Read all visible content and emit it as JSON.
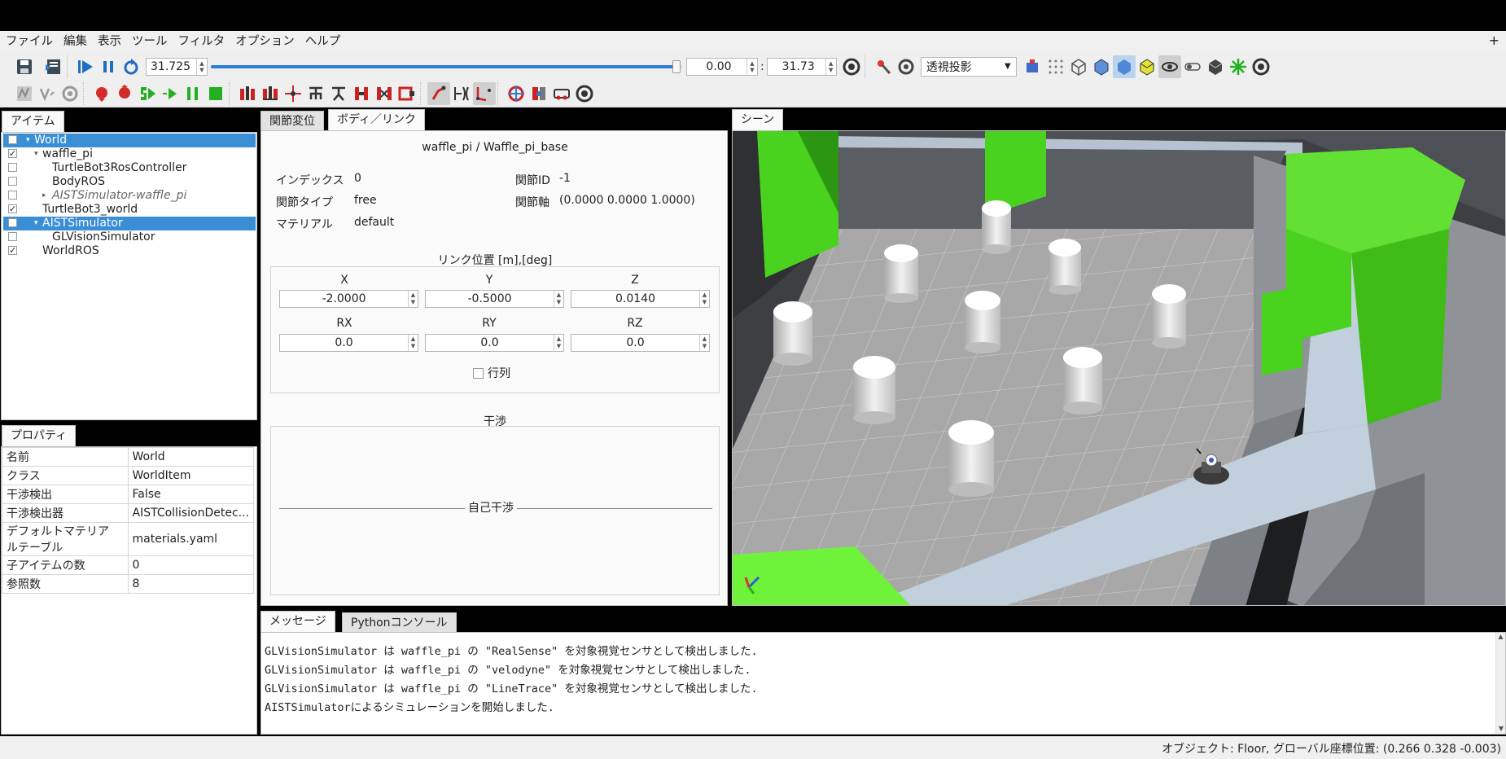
{
  "menu": [
    "ファイル",
    "編集",
    "表示",
    "ツール",
    "フィルタ",
    "オプション",
    "ヘルプ"
  ],
  "menu_plus": "+",
  "toolbar": {
    "time_value": "31.725",
    "time_progress": 0.99,
    "range_start": "0.00",
    "range_sep": ":",
    "range_end": "31.73",
    "projection": "透視投影"
  },
  "items_pane": {
    "tab": "アイテム",
    "rows": [
      {
        "label": "World",
        "checked": false,
        "selected": true,
        "indent": 0,
        "arrow": "▾"
      },
      {
        "label": "waffle_pi",
        "checked": true,
        "selected": false,
        "indent": 1,
        "arrow": "▾"
      },
      {
        "label": "TurtleBot3RosController",
        "checked": false,
        "selected": false,
        "indent": 2,
        "arrow": ""
      },
      {
        "label": "BodyROS",
        "checked": false,
        "selected": false,
        "indent": 2,
        "arrow": ""
      },
      {
        "label": "AISTSimulator-waffle_pi",
        "checked": false,
        "selected": false,
        "indent": 2,
        "arrow": "▸",
        "italic": true
      },
      {
        "label": "TurtleBot3_world",
        "checked": true,
        "selected": false,
        "indent": 1,
        "arrow": ""
      },
      {
        "label": "AISTSimulator",
        "checked": false,
        "selected": true,
        "indent": 1,
        "arrow": "▾"
      },
      {
        "label": "GLVisionSimulator",
        "checked": false,
        "selected": false,
        "indent": 2,
        "arrow": ""
      },
      {
        "label": "WorldROS",
        "checked": true,
        "selected": false,
        "indent": 1,
        "arrow": ""
      }
    ]
  },
  "properties_pane": {
    "tab": "プロパティ",
    "rows": [
      {
        "name": "名前",
        "value": "World"
      },
      {
        "name": "クラス",
        "value": "WorldItem"
      },
      {
        "name": "干渉検出",
        "value": "False"
      },
      {
        "name": "干渉検出器",
        "value": "AISTCollisionDetec..."
      },
      {
        "name": "デフォルトマテリア\nルテーブル",
        "value": "materials.yaml"
      },
      {
        "name": "子アイテムの数",
        "value": "0"
      },
      {
        "name": "参照数",
        "value": "8"
      }
    ]
  },
  "link_pane": {
    "tabs": [
      "関節変位",
      "ボディ／リンク"
    ],
    "active_tab": 1,
    "title": "waffle_pi / Waffle_pi_base",
    "index_label": "インデックス",
    "index_value": "0",
    "joint_id_label": "関節ID",
    "joint_id_value": "-1",
    "joint_type_label": "関節タイプ",
    "joint_type_value": "free",
    "joint_axis_label": "関節軸",
    "joint_axis_value": "(0.0000 0.0000 1.0000)",
    "material_label": "マテリアル",
    "material_value": "default",
    "position_title": "リンク位置 [m],[deg]",
    "x_label": "X",
    "x_value": "-2.0000",
    "y_label": "Y",
    "y_value": "-0.5000",
    "z_label": "Z",
    "z_value": "0.0140",
    "rx_label": "RX",
    "rx_value": "0.0",
    "ry_label": "RY",
    "ry_value": "0.0",
    "rz_label": "RZ",
    "rz_value": "0.0",
    "matrix_label": "行列",
    "collision_title": "干渉",
    "self_collision_label": "自己干渉"
  },
  "scene_pane": {
    "tab": "シーン"
  },
  "message_pane": {
    "tabs": [
      "メッセージ",
      "Pythonコンソール"
    ],
    "lines": [
      "GLVisionSimulator は waffle_pi の \"RealSense\" を対象視覚センサとして検出しました.",
      "GLVisionSimulator は waffle_pi の \"velodyne\" を対象視覚センサとして検出しました.",
      "GLVisionSimulator は waffle_pi の \"LineTrace\" を対象視覚センサとして検出しました.",
      "AISTSimulatorによるシミュレーションを開始しました."
    ]
  },
  "status_bar": {
    "text": "オブジェクト: Floor, グローバル座標位置: (0.266 0.328 -0.003)"
  },
  "colors": {
    "selection": "#3a8ed6",
    "wall_green": "#4fd12a",
    "floor_gray": "#a9a9a9",
    "wall_dark": "#565a5e",
    "path_light": "#c2cfdc"
  }
}
